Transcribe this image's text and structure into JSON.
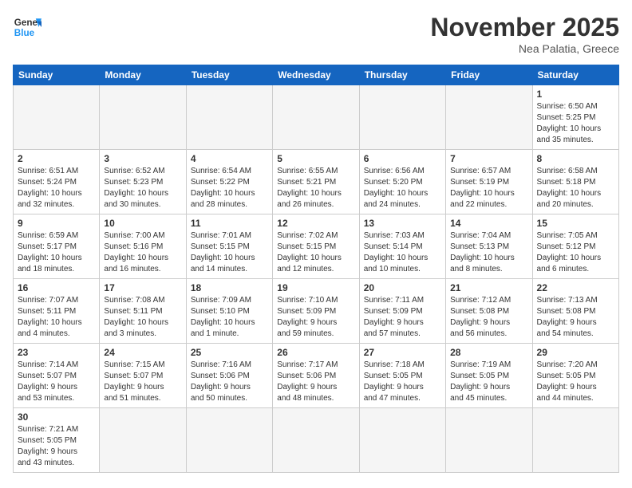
{
  "logo": {
    "line1": "General",
    "line2": "Blue"
  },
  "title": "November 2025",
  "subtitle": "Nea Palatia, Greece",
  "days_header": [
    "Sunday",
    "Monday",
    "Tuesday",
    "Wednesday",
    "Thursday",
    "Friday",
    "Saturday"
  ],
  "weeks": [
    [
      {
        "day": "",
        "info": ""
      },
      {
        "day": "",
        "info": ""
      },
      {
        "day": "",
        "info": ""
      },
      {
        "day": "",
        "info": ""
      },
      {
        "day": "",
        "info": ""
      },
      {
        "day": "",
        "info": ""
      },
      {
        "day": "1",
        "info": "Sunrise: 6:50 AM\nSunset: 5:25 PM\nDaylight: 10 hours\nand 35 minutes."
      }
    ],
    [
      {
        "day": "2",
        "info": "Sunrise: 6:51 AM\nSunset: 5:24 PM\nDaylight: 10 hours\nand 32 minutes."
      },
      {
        "day": "3",
        "info": "Sunrise: 6:52 AM\nSunset: 5:23 PM\nDaylight: 10 hours\nand 30 minutes."
      },
      {
        "day": "4",
        "info": "Sunrise: 6:54 AM\nSunset: 5:22 PM\nDaylight: 10 hours\nand 28 minutes."
      },
      {
        "day": "5",
        "info": "Sunrise: 6:55 AM\nSunset: 5:21 PM\nDaylight: 10 hours\nand 26 minutes."
      },
      {
        "day": "6",
        "info": "Sunrise: 6:56 AM\nSunset: 5:20 PM\nDaylight: 10 hours\nand 24 minutes."
      },
      {
        "day": "7",
        "info": "Sunrise: 6:57 AM\nSunset: 5:19 PM\nDaylight: 10 hours\nand 22 minutes."
      },
      {
        "day": "8",
        "info": "Sunrise: 6:58 AM\nSunset: 5:18 PM\nDaylight: 10 hours\nand 20 minutes."
      }
    ],
    [
      {
        "day": "9",
        "info": "Sunrise: 6:59 AM\nSunset: 5:17 PM\nDaylight: 10 hours\nand 18 minutes."
      },
      {
        "day": "10",
        "info": "Sunrise: 7:00 AM\nSunset: 5:16 PM\nDaylight: 10 hours\nand 16 minutes."
      },
      {
        "day": "11",
        "info": "Sunrise: 7:01 AM\nSunset: 5:15 PM\nDaylight: 10 hours\nand 14 minutes."
      },
      {
        "day": "12",
        "info": "Sunrise: 7:02 AM\nSunset: 5:15 PM\nDaylight: 10 hours\nand 12 minutes."
      },
      {
        "day": "13",
        "info": "Sunrise: 7:03 AM\nSunset: 5:14 PM\nDaylight: 10 hours\nand 10 minutes."
      },
      {
        "day": "14",
        "info": "Sunrise: 7:04 AM\nSunset: 5:13 PM\nDaylight: 10 hours\nand 8 minutes."
      },
      {
        "day": "15",
        "info": "Sunrise: 7:05 AM\nSunset: 5:12 PM\nDaylight: 10 hours\nand 6 minutes."
      }
    ],
    [
      {
        "day": "16",
        "info": "Sunrise: 7:07 AM\nSunset: 5:11 PM\nDaylight: 10 hours\nand 4 minutes."
      },
      {
        "day": "17",
        "info": "Sunrise: 7:08 AM\nSunset: 5:11 PM\nDaylight: 10 hours\nand 3 minutes."
      },
      {
        "day": "18",
        "info": "Sunrise: 7:09 AM\nSunset: 5:10 PM\nDaylight: 10 hours\nand 1 minute."
      },
      {
        "day": "19",
        "info": "Sunrise: 7:10 AM\nSunset: 5:09 PM\nDaylight: 9 hours\nand 59 minutes."
      },
      {
        "day": "20",
        "info": "Sunrise: 7:11 AM\nSunset: 5:09 PM\nDaylight: 9 hours\nand 57 minutes."
      },
      {
        "day": "21",
        "info": "Sunrise: 7:12 AM\nSunset: 5:08 PM\nDaylight: 9 hours\nand 56 minutes."
      },
      {
        "day": "22",
        "info": "Sunrise: 7:13 AM\nSunset: 5:08 PM\nDaylight: 9 hours\nand 54 minutes."
      }
    ],
    [
      {
        "day": "23",
        "info": "Sunrise: 7:14 AM\nSunset: 5:07 PM\nDaylight: 9 hours\nand 53 minutes."
      },
      {
        "day": "24",
        "info": "Sunrise: 7:15 AM\nSunset: 5:07 PM\nDaylight: 9 hours\nand 51 minutes."
      },
      {
        "day": "25",
        "info": "Sunrise: 7:16 AM\nSunset: 5:06 PM\nDaylight: 9 hours\nand 50 minutes."
      },
      {
        "day": "26",
        "info": "Sunrise: 7:17 AM\nSunset: 5:06 PM\nDaylight: 9 hours\nand 48 minutes."
      },
      {
        "day": "27",
        "info": "Sunrise: 7:18 AM\nSunset: 5:05 PM\nDaylight: 9 hours\nand 47 minutes."
      },
      {
        "day": "28",
        "info": "Sunrise: 7:19 AM\nSunset: 5:05 PM\nDaylight: 9 hours\nand 45 minutes."
      },
      {
        "day": "29",
        "info": "Sunrise: 7:20 AM\nSunset: 5:05 PM\nDaylight: 9 hours\nand 44 minutes."
      }
    ],
    [
      {
        "day": "30",
        "info": "Sunrise: 7:21 AM\nSunset: 5:05 PM\nDaylight: 9 hours\nand 43 minutes."
      },
      {
        "day": "",
        "info": ""
      },
      {
        "day": "",
        "info": ""
      },
      {
        "day": "",
        "info": ""
      },
      {
        "day": "",
        "info": ""
      },
      {
        "day": "",
        "info": ""
      },
      {
        "day": "",
        "info": ""
      }
    ]
  ]
}
